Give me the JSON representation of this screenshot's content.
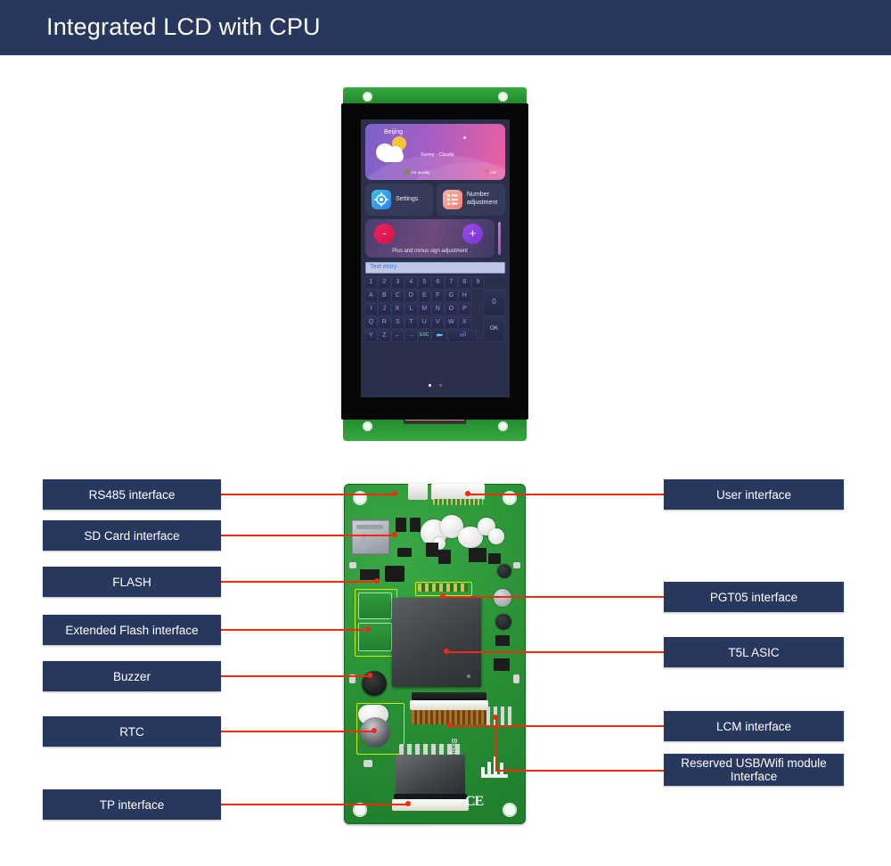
{
  "header": {
    "title": "Integrated LCD with CPU",
    "bg_color": "#27375e",
    "text_color": "#ffffff"
  },
  "theme": {
    "label_box_color": "#27375e",
    "leader_line_color": "#f22a10",
    "pcb_green": "#2a9236",
    "page_background": "#ffffff"
  },
  "lcd_screen": {
    "weather": {
      "city": "Beijing",
      "condition": "Sunny - Cloudy",
      "air_quality_label": "Air quality",
      "uv_label": "UV",
      "leaf_icon": "leaf-icon",
      "sun_icon": "sun-icon",
      "cloud_icon": "cloud-sun-icon"
    },
    "tiles": [
      {
        "label": "Settings",
        "icon": "gear-icon",
        "icon_color": "#2f9fe8"
      },
      {
        "label": "Number adjustment",
        "icon": "list-icon",
        "icon_color": "#f3837d"
      }
    ],
    "plus_minus": {
      "minus_label": "-",
      "plus_label": "+",
      "caption": "Plus and minus sign adjustment",
      "minus_color": "#e4164f",
      "plus_color": "#8b3fe0"
    },
    "text_entry": {
      "value": "Text entry",
      "placeholder": "Text entry",
      "text_color": "#3e7fd8"
    },
    "keyboard": {
      "row1": [
        "1",
        "2",
        "3",
        "4",
        "5",
        "6",
        "7",
        "8",
        "9"
      ],
      "row2": [
        "A",
        "B",
        "C",
        "D",
        "E",
        "F",
        "G",
        "H"
      ],
      "row3": [
        "I",
        "J",
        "K",
        "L",
        "M",
        "N",
        "O",
        "P"
      ],
      "row4": [
        "Q",
        "R",
        "S",
        "T",
        "U",
        "V",
        "W",
        "X"
      ],
      "row5": [
        "Y",
        "Z",
        "←",
        "→",
        "ESC",
        "⬅",
        "⏎"
      ],
      "zero_key": "0",
      "ok_key": "OK"
    },
    "page_dots": {
      "count": 2,
      "active_index": 0
    }
  },
  "callouts": {
    "left": [
      {
        "label": "RS485 interface"
      },
      {
        "label": "SD Card interface"
      },
      {
        "label": "FLASH"
      },
      {
        "label": "Extended Flash interface"
      },
      {
        "label": "Buzzer"
      },
      {
        "label": "RTC"
      },
      {
        "label": "TP interface"
      }
    ],
    "right": [
      {
        "label": "User interface"
      },
      {
        "label": "PGT05 interface"
      },
      {
        "label": "T5L ASIC"
      },
      {
        "label": "LCM interface"
      },
      {
        "label": "Reserved USB/Wifi module Interface"
      }
    ]
  },
  "board_silk": {
    "ce_mark": "CE",
    "brand": "Bxsg"
  }
}
